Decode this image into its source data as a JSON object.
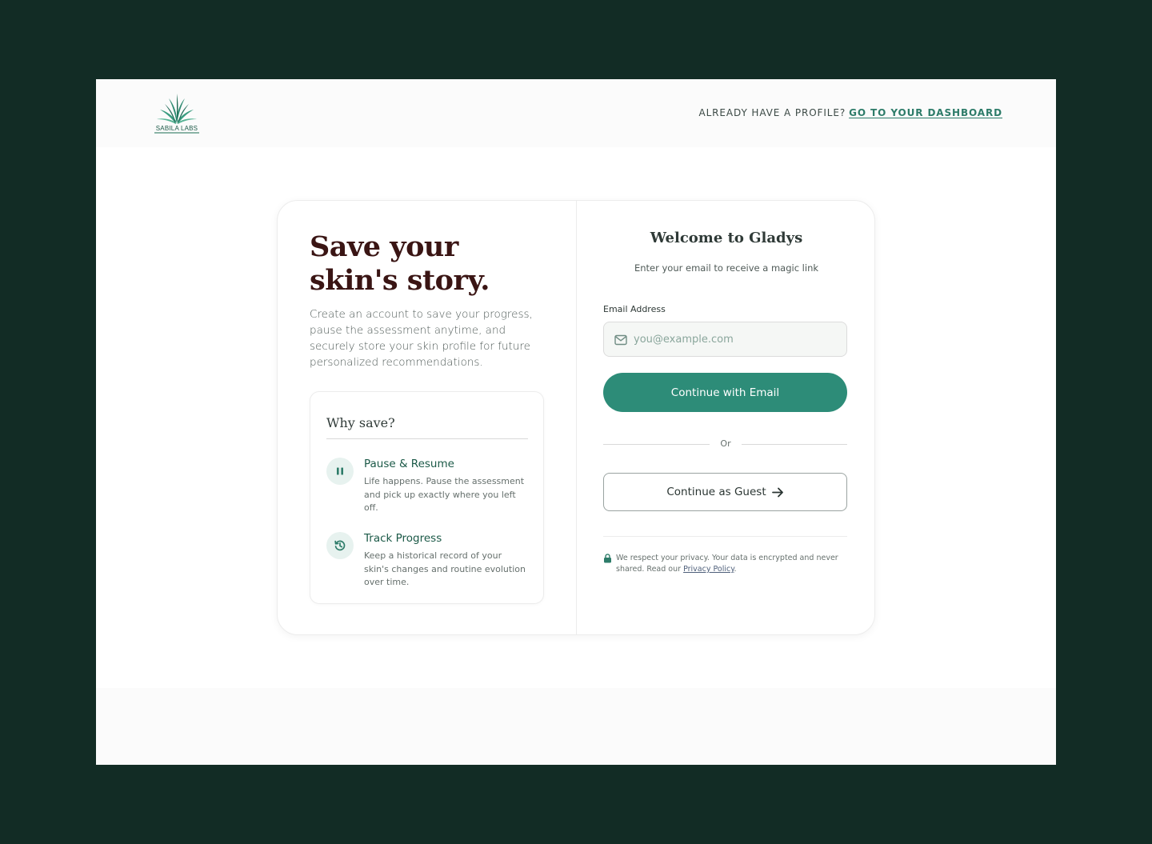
{
  "brand": {
    "name": "SABILA LABS",
    "accent_color": "#2d8c78",
    "dark_background": "#122c25",
    "headline_color": "#3a1514"
  },
  "header": {
    "prompt": "ALREADY HAVE A PROFILE?",
    "dashboard_link": "GO TO YOUR DASHBOARD"
  },
  "left_panel": {
    "headline": "Save your skin's story.",
    "intro": "Create an account to save your progress, pause the assessment anytime, and securely store your skin profile for future personalized recommendations.",
    "why": {
      "title": "Why save?",
      "features": [
        {
          "icon": "pause-icon",
          "title": "Pause & Resume",
          "description": "Life happens. Pause the assessment and pick up exactly where you left off."
        },
        {
          "icon": "history-icon",
          "title": "Track Progress",
          "description": "Keep a historical record of your skin's changes and routine evolution over time."
        }
      ]
    }
  },
  "right_panel": {
    "title": "Welcome to Gladys",
    "subtitle": "Enter your email to receive a magic link",
    "email": {
      "label": "Email Address",
      "placeholder": "you@example.com",
      "value": ""
    },
    "continue_email_label": "Continue with Email",
    "divider_text": "Or",
    "guest_label": "Continue as Guest",
    "privacy_text": "We respect your privacy. Your data is encrypted and never shared. Read our",
    "privacy_link": "Privacy Policy",
    "privacy_end": "."
  }
}
